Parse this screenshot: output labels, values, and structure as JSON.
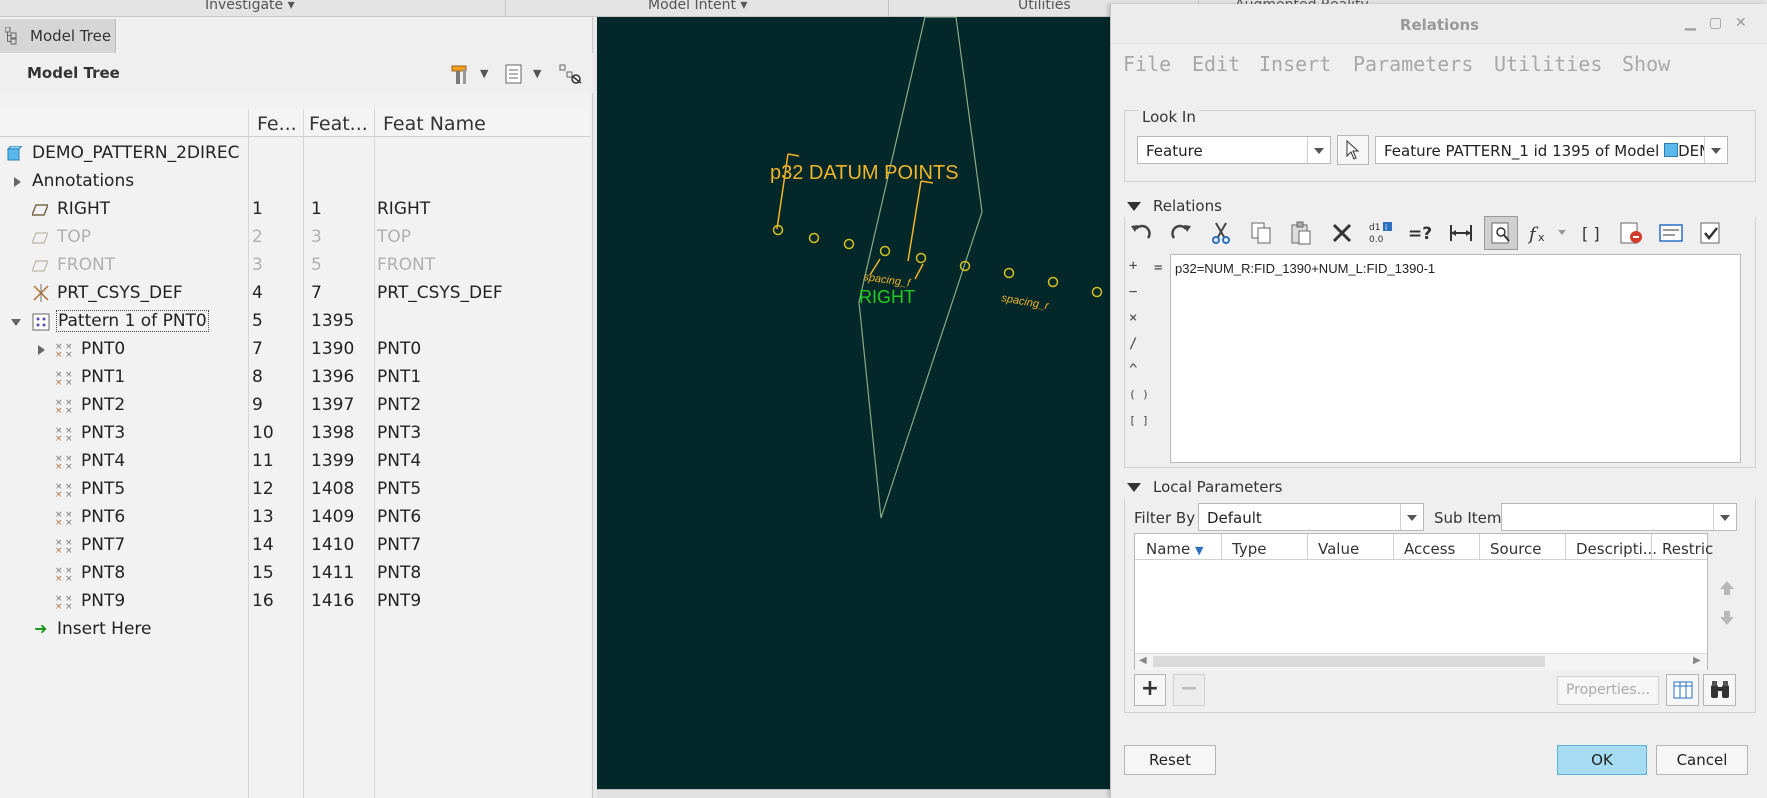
{
  "ribbon": {
    "items": [
      "Investigate",
      "Model Intent",
      "Utilities",
      "Augmented Reality"
    ]
  },
  "model_tree": {
    "tab_label": "Model Tree",
    "header_title": "Model Tree",
    "columns": [
      "Fe...",
      "Feat...",
      "Feat Name"
    ],
    "rows": [
      {
        "name": "DEMO_PATTERN_2DIREC",
        "c1": "",
        "c2": "",
        "c3": "",
        "icon": "part-icon"
      },
      {
        "name": "Annotations",
        "c1": "",
        "c2": "",
        "c3": "",
        "icon": ""
      },
      {
        "name": "RIGHT",
        "c1": "1",
        "c2": "1",
        "c3": "RIGHT",
        "icon": "datum-plane-icon"
      },
      {
        "name": "TOP",
        "c1": "2",
        "c2": "3",
        "c3": "TOP",
        "icon": "datum-plane-icon"
      },
      {
        "name": "FRONT",
        "c1": "3",
        "c2": "5",
        "c3": "FRONT",
        "icon": "datum-plane-icon"
      },
      {
        "name": "PRT_CSYS_DEF",
        "c1": "4",
        "c2": "7",
        "c3": "PRT_CSYS_DEF",
        "icon": "csys-icon"
      },
      {
        "name": "Pattern 1 of PNT0",
        "c1": "5",
        "c2": "1395",
        "c3": "",
        "icon": "pattern-icon"
      },
      {
        "name": "PNT0",
        "c1": "7",
        "c2": "1390",
        "c3": "PNT0",
        "icon": "datum-point-icon"
      },
      {
        "name": "PNT1",
        "c1": "8",
        "c2": "1396",
        "c3": "PNT1",
        "icon": "datum-point-icon"
      },
      {
        "name": "PNT2",
        "c1": "9",
        "c2": "1397",
        "c3": "PNT2",
        "icon": "datum-point-icon"
      },
      {
        "name": "PNT3",
        "c1": "10",
        "c2": "1398",
        "c3": "PNT3",
        "icon": "datum-point-icon"
      },
      {
        "name": "PNT4",
        "c1": "11",
        "c2": "1399",
        "c3": "PNT4",
        "icon": "datum-point-icon"
      },
      {
        "name": "PNT5",
        "c1": "12",
        "c2": "1408",
        "c3": "PNT5",
        "icon": "datum-point-icon"
      },
      {
        "name": "PNT6",
        "c1": "13",
        "c2": "1409",
        "c3": "PNT6",
        "icon": "datum-point-icon"
      },
      {
        "name": "PNT7",
        "c1": "14",
        "c2": "1410",
        "c3": "PNT7",
        "icon": "datum-point-icon"
      },
      {
        "name": "PNT8",
        "c1": "15",
        "c2": "1411",
        "c3": "PNT8",
        "icon": "datum-point-icon"
      },
      {
        "name": "PNT9",
        "c1": "16",
        "c2": "1416",
        "c3": "PNT9",
        "icon": "datum-point-icon"
      },
      {
        "name": "Insert Here",
        "c1": "",
        "c2": "",
        "c3": "",
        "icon": "insert-arrow-icon"
      }
    ]
  },
  "viewport": {
    "annotation": "p32 DATUM POINTS",
    "plane_label": "RIGHT",
    "dim_label_1": "spacing_f",
    "dim_label_2": "spacing_r"
  },
  "relations_dialog": {
    "title": "Relations",
    "menus": [
      "File",
      "Edit",
      "Insert",
      "Parameters",
      "Utilities",
      "Show"
    ],
    "look_in": {
      "label": "Look In",
      "type_value": "Feature",
      "target_value": "Feature PATTERN_1 id 1395 of Model",
      "model_name": "DEMO_F"
    },
    "relations": {
      "label": "Relations",
      "operators": [
        "+",
        "−",
        "×",
        "/",
        "^",
        "( )",
        "[ ]"
      ],
      "equals": "=",
      "text": "p32=NUM_R:FID_1390+NUM_L:FID_1390-1"
    },
    "local_parameters": {
      "label": "Local Parameters",
      "filter_label": "Filter By",
      "filter_value": "Default",
      "subitems_label": "Sub Items",
      "subitems_value": "",
      "columns": [
        "Name",
        "Type",
        "Value",
        "Access",
        "Source",
        "Descripti...",
        "Restric"
      ],
      "properties_button": "Properties..."
    },
    "buttons": {
      "reset": "Reset",
      "ok": "OK",
      "cancel": "Cancel"
    },
    "colors": {
      "viewport_bg": "#04282a",
      "annotation": "#f0b429",
      "plane_label": "#22cc22",
      "ok_button": "#a6dcf2"
    }
  }
}
